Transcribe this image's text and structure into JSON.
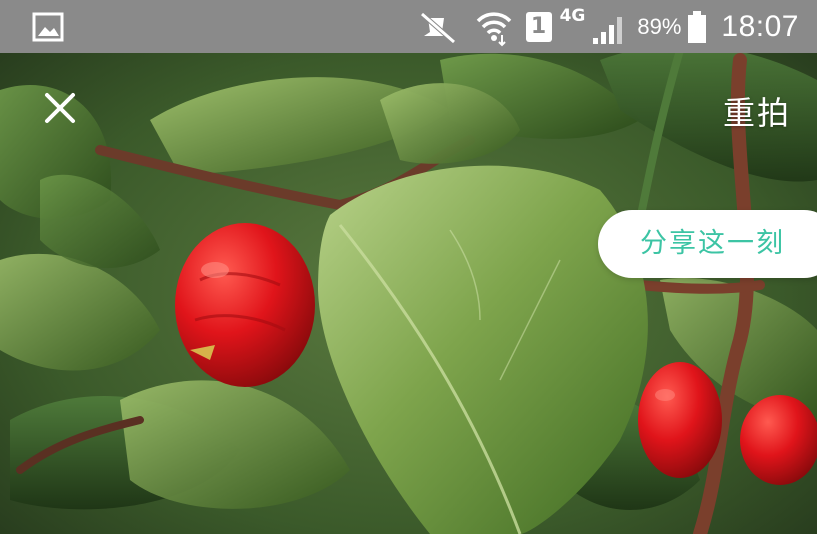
{
  "status_bar": {
    "network_type": "4G",
    "sim_slot": "1",
    "battery_percent": "89%",
    "time": "18:07",
    "icons": [
      "gallery-icon",
      "mute-icon",
      "wifi-icon",
      "sim-icon",
      "signal-icon",
      "battery-icon"
    ]
  },
  "toolbar": {
    "close_icon": "close-icon",
    "retake_label": "重拍"
  },
  "share": {
    "label": "分享这一刻",
    "color": "#3cc4a4"
  }
}
